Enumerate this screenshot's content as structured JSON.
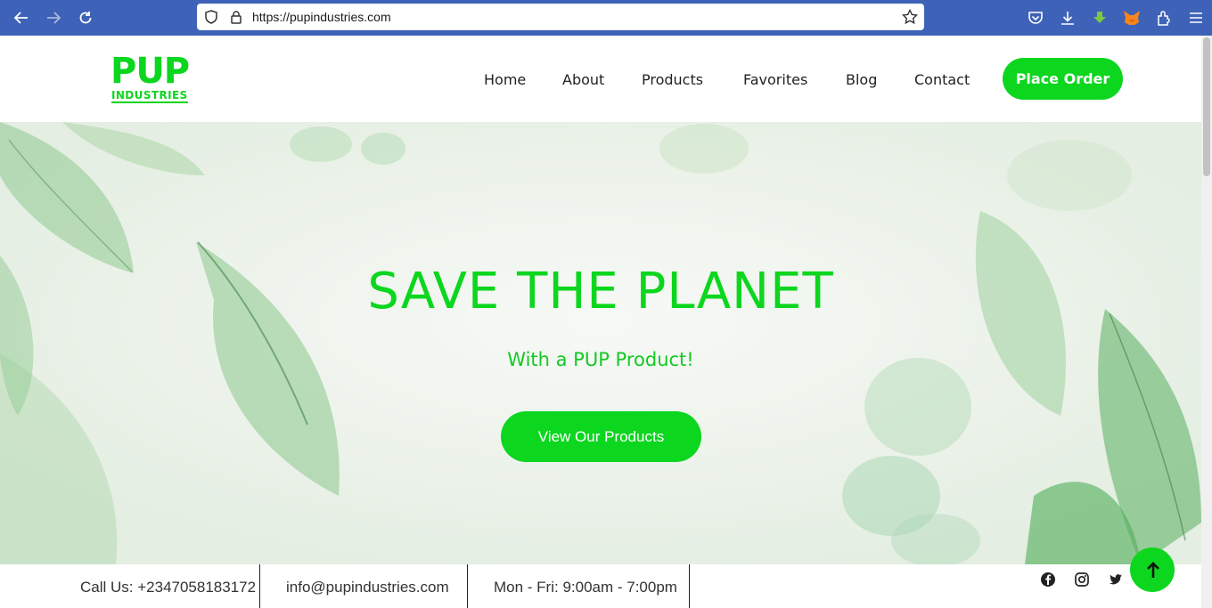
{
  "browser": {
    "url": "https://pupindustries.com",
    "icons": [
      "back-icon",
      "forward-icon",
      "reload-icon",
      "shield-icon",
      "lock-icon",
      "bookmark-star-icon",
      "pocket-icon",
      "download-icon",
      "extension-download-icon",
      "fox-extension-icon",
      "extensions-icon",
      "menu-icon"
    ]
  },
  "logo": {
    "line1": "PUP",
    "line2": "INDUSTRIES"
  },
  "nav": {
    "home": "Home",
    "about": "About",
    "products": "Products",
    "favorites": "Favorites",
    "blog": "Blog",
    "contact": "Contact",
    "place_order": "Place Order"
  },
  "hero": {
    "title": "SAVE THE PLANET",
    "subtitle": "With a PUP Product!",
    "cta": "View Our Products"
  },
  "topbar": {
    "phone": "Call Us: +2347058183172",
    "email": "info@pupindustries.com",
    "hours": "Mon - Fri: 9:00am - 7:00pm",
    "social": [
      "facebook-icon",
      "instagram-icon",
      "twitter-icon"
    ]
  },
  "colors": {
    "accent": "#0cd61e",
    "browser": "#3e62b7"
  }
}
